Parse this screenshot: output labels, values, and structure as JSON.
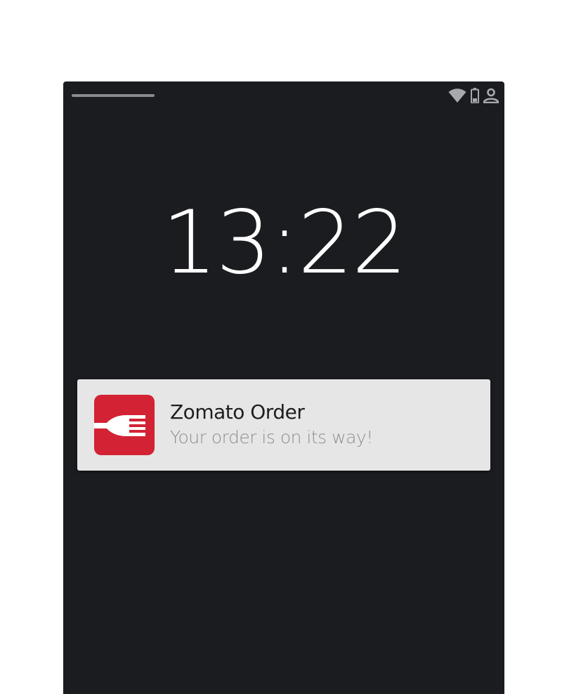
{
  "lockscreen": {
    "time": "13:22"
  },
  "status_bar": {
    "icons": [
      "wifi-icon",
      "battery-icon",
      "user-icon"
    ],
    "icon_color": "#a8a9ad"
  },
  "notification": {
    "app_icon": "fork-icon",
    "app_icon_color": "#d32234",
    "title": "Zomato Order",
    "body": "Your order is on its way!"
  },
  "colors": {
    "background": "#1b1c20",
    "notification_bg": "#e6e6e6"
  }
}
